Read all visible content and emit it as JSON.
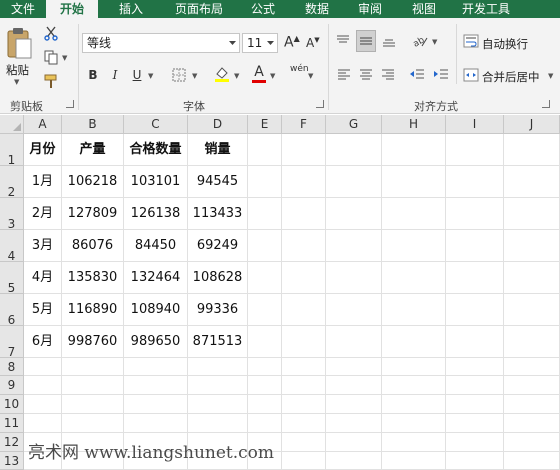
{
  "ribbon_tabs": [
    {
      "label": "文件",
      "active": false
    },
    {
      "label": "开始",
      "active": true
    },
    {
      "label": "插入",
      "active": false
    },
    {
      "label": "页面布局",
      "active": false
    },
    {
      "label": "公式",
      "active": false
    },
    {
      "label": "数据",
      "active": false
    },
    {
      "label": "审阅",
      "active": false
    },
    {
      "label": "视图",
      "active": false
    },
    {
      "label": "开发工具",
      "active": false
    }
  ],
  "clipboard": {
    "paste_label": "粘贴",
    "group_label": "剪贴板"
  },
  "font": {
    "name": "等线",
    "size": "11",
    "group_label": "字体",
    "bold": "B",
    "italic": "I",
    "underline": "U",
    "grow": "A",
    "shrink": "A",
    "font_color_glyph": "A",
    "phonetic_glyph": "wén",
    "font_color": "#e00000",
    "fill_color": "#ffff00"
  },
  "alignment": {
    "wrap_text_label": "自动换行",
    "merge_center_label": "合并后居中",
    "group_label": "对齐方式"
  },
  "grid": {
    "columns": [
      "A",
      "B",
      "C",
      "D",
      "E",
      "F",
      "G",
      "H",
      "I",
      "J"
    ],
    "rows": [
      "1",
      "2",
      "3",
      "4",
      "5",
      "6",
      "7",
      "8",
      "9",
      "10",
      "11",
      "12",
      "13"
    ],
    "cells": [
      [
        "月份",
        "产量",
        "合格数量",
        "销量"
      ],
      [
        "1月",
        "106218",
        "103101",
        "94545"
      ],
      [
        "2月",
        "127809",
        "126138",
        "113433"
      ],
      [
        "3月",
        "86076",
        "84450",
        "69249"
      ],
      [
        "4月",
        "135830",
        "132464",
        "108628"
      ],
      [
        "5月",
        "116890",
        "108940",
        "99336"
      ],
      [
        "6月",
        "998760",
        "989650",
        "871513"
      ]
    ]
  },
  "watermark": "亮术网 www.liangshunet.com",
  "colors": {
    "ribbon_accent": "#217346"
  }
}
